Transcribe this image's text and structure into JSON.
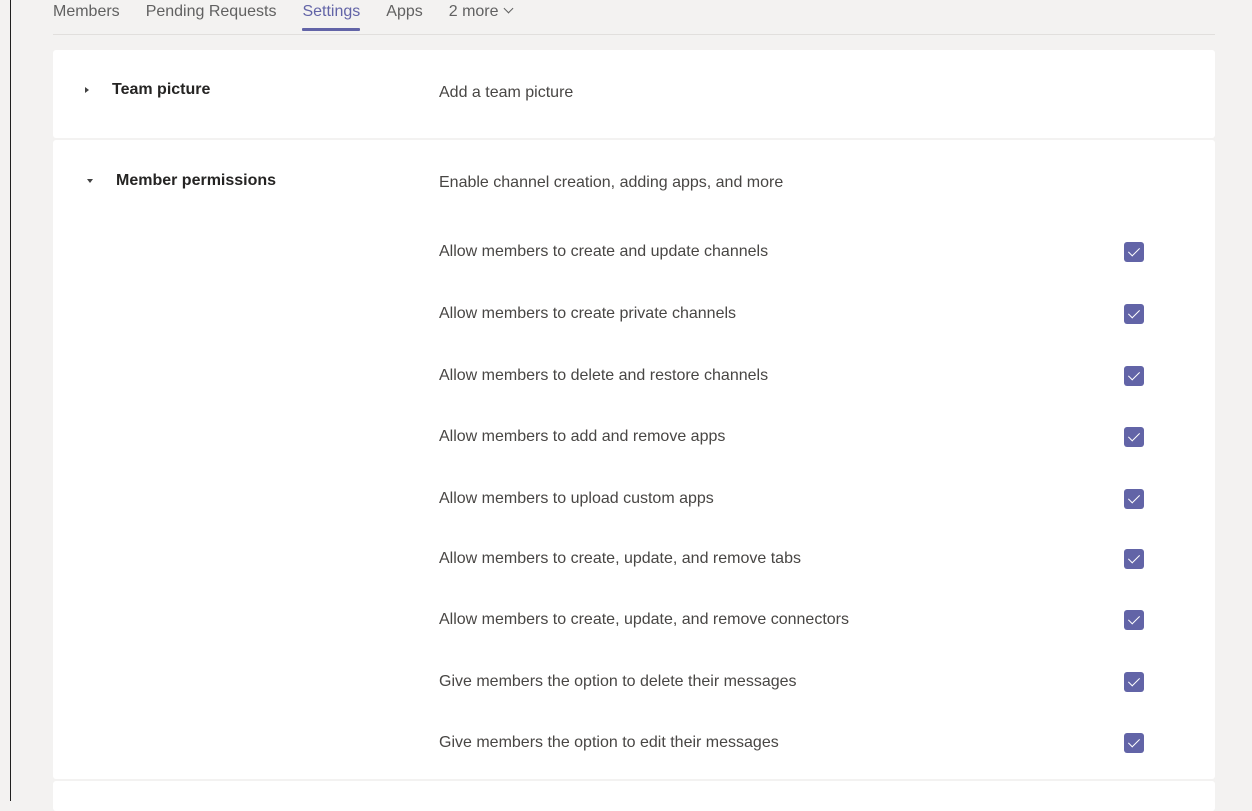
{
  "tabs": {
    "members": "Members",
    "pending": "Pending Requests",
    "settings": "Settings",
    "apps": "Apps",
    "more": "2 more"
  },
  "team_picture": {
    "title": "Team picture",
    "description": "Add a team picture"
  },
  "member_permissions": {
    "title": "Member permissions",
    "description": "Enable channel creation, adding apps, and more",
    "options": [
      {
        "label": "Allow members to create and update channels",
        "checked": true
      },
      {
        "label": "Allow members to create private channels",
        "checked": true
      },
      {
        "label": "Allow members to delete and restore channels",
        "checked": true
      },
      {
        "label": "Allow members to add and remove apps",
        "checked": true
      },
      {
        "label": "Allow members to upload custom apps",
        "checked": true
      },
      {
        "label": "Allow members to create, update, and remove tabs",
        "checked": true
      },
      {
        "label": "Allow members to create, update, and remove connectors",
        "checked": true
      },
      {
        "label": "Give members the option to delete their messages",
        "checked": true
      },
      {
        "label": "Give members the option to edit their messages",
        "checked": true
      }
    ]
  },
  "colors": {
    "accent": "#6264a7",
    "background": "#f3f2f1",
    "card": "#ffffff"
  }
}
